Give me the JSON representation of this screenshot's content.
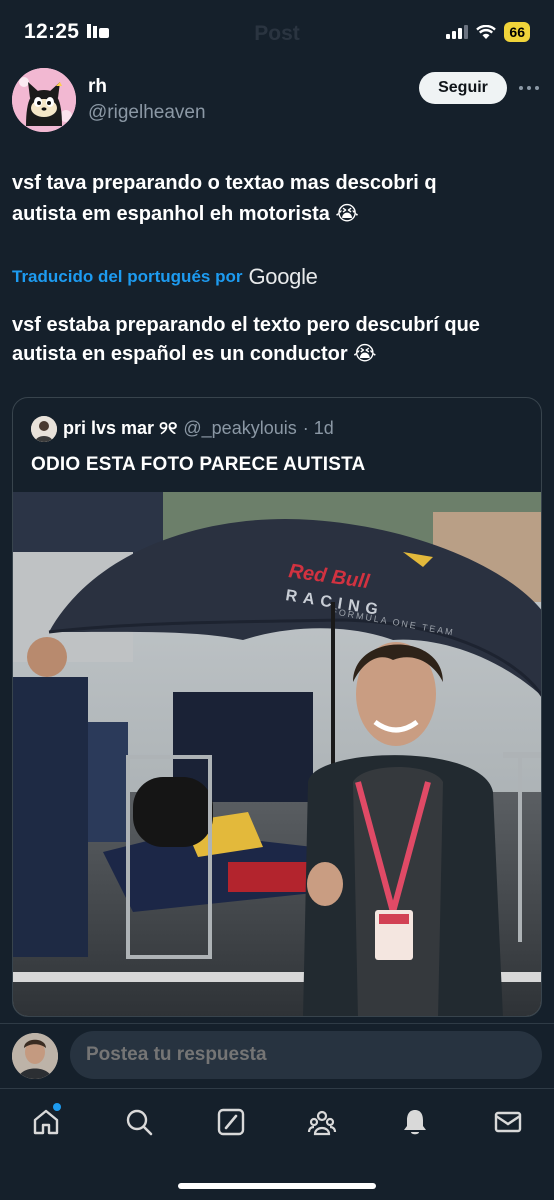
{
  "status_bar": {
    "time": "12:25",
    "battery": "66",
    "ghost_title": "Post"
  },
  "post": {
    "display_name": "rh",
    "handle": "@rigelheaven",
    "follow_label": "Seguir",
    "text_line1": "vsf tava preparando o textao mas descobri q",
    "text_line2": "autista em espanhol eh motorista 😭",
    "translated_by": "Traducido del portugués por",
    "translator": "Google",
    "translated_line1": "vsf estaba preparando el texto pero descubrí que",
    "translated_line2": "autista en español es un conductor 😭"
  },
  "quote": {
    "name": "pri lvs mar ୨୧",
    "handle": "@_peakylouis",
    "time": "· 1d",
    "text": "ODIO ESTA FOTO PARECE AUTISTA",
    "umbrella_brand": "Red Bull",
    "umbrella_line2": "RACING",
    "umbrella_line3": "FORMULA ONE TEAM"
  },
  "reply": {
    "placeholder": "Postea tu respuesta"
  },
  "nav": {
    "items": [
      "home-icon",
      "search-icon",
      "grok-icon",
      "communities-icon",
      "notifications-icon",
      "messages-icon"
    ]
  },
  "colors": {
    "background": "#15202b",
    "accent": "#1d9bf0",
    "muted": "#8b98a5"
  }
}
